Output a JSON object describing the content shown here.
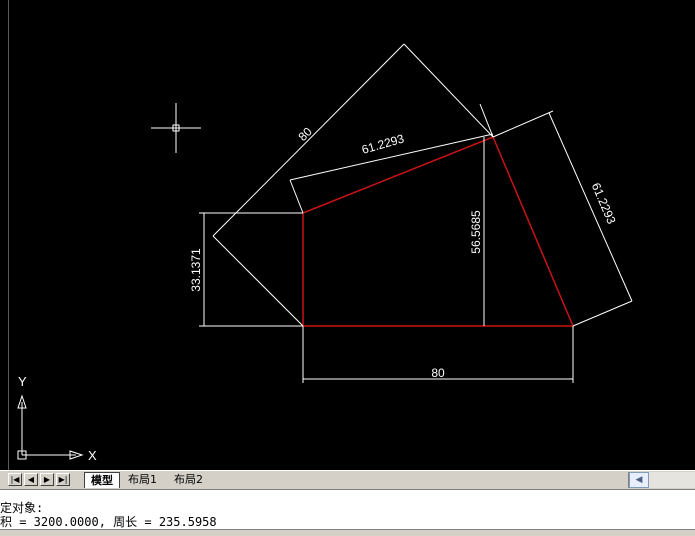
{
  "drawing": {
    "dim_80_diagonal": "80",
    "dim_61_top": "61.2293",
    "dim_61_right": "61.2293",
    "dim_56": "56.5685",
    "dim_33": "33.1371",
    "dim_80_bottom": "80",
    "axis_x": "X",
    "axis_y": "Y",
    "colors": {
      "outline": "#c81414",
      "dimension": "#ffffff",
      "background": "#000000"
    }
  },
  "layout_tabs": [
    {
      "label": "模型",
      "active": true
    },
    {
      "label": "布局1",
      "active": false
    },
    {
      "label": "布局2",
      "active": false
    }
  ],
  "nav_icons": [
    "first-icon",
    "prev-icon",
    "next-icon",
    "last-icon"
  ],
  "command": {
    "line1": "定对象:",
    "line2": "积 = 3200.0000, 周长 = 235.5958"
  }
}
